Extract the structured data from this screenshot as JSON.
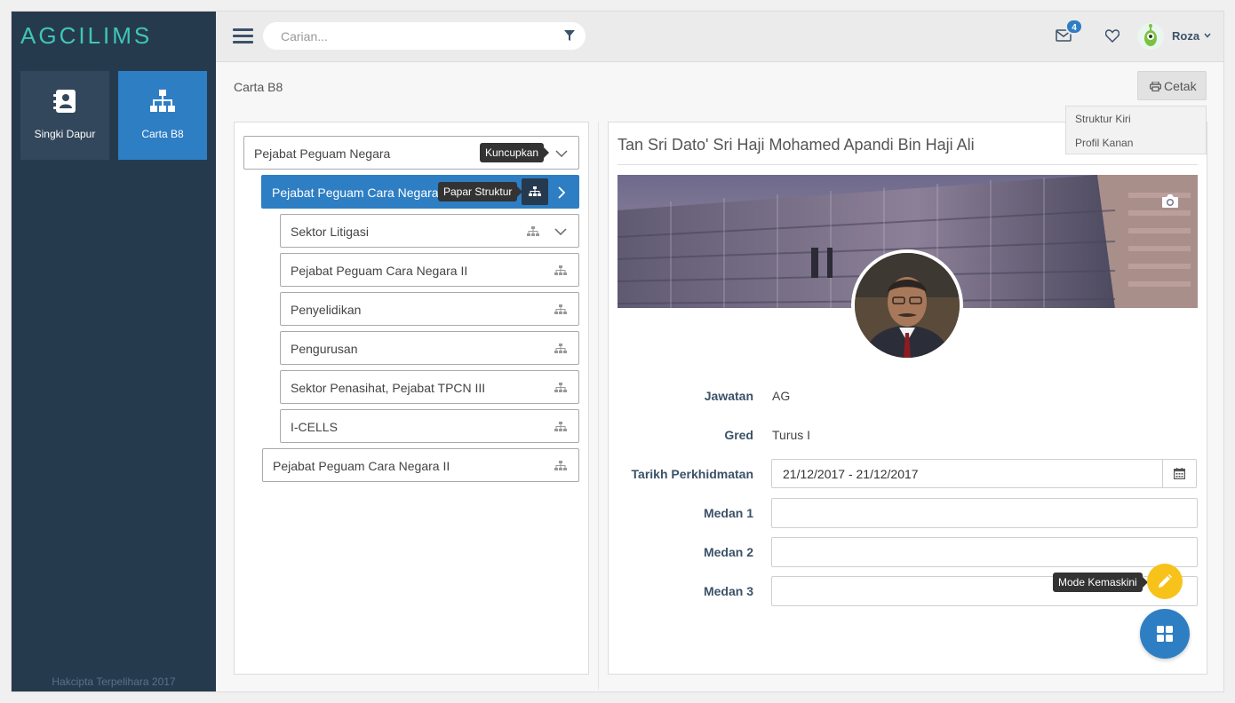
{
  "app": {
    "logo": "AGCILIMS",
    "copyright": "Hakcipta Terpelihara 2017"
  },
  "sidebar": {
    "items": [
      {
        "label": "Singki Dapur",
        "icon": "address-book-icon"
      },
      {
        "label": "Carta B8",
        "icon": "sitemap-icon",
        "active": true
      }
    ]
  },
  "header": {
    "search_placeholder": "Carian...",
    "mail_count": "4",
    "user_name": "Roza"
  },
  "page": {
    "breadcrumb": "Carta B8",
    "print_label": "Cetak",
    "print_menu": [
      "Struktur Kiri",
      "Profil Kanan"
    ]
  },
  "tree": {
    "root": {
      "label": "Pejabat Peguam Negara",
      "tooltip": "Kuncupkan"
    },
    "active": {
      "label": "Pejabat Peguam Cara Negara",
      "tooltip": "Papar Struktur"
    },
    "children": [
      "Sektor Litigasi",
      "Pejabat Peguam Cara Negara II",
      "Penyelidikan",
      "Pengurusan",
      "Sektor Penasihat, Pejabat TPCN III",
      "I-CELLS"
    ],
    "sibling": "Pejabat Peguam Cara Negara II"
  },
  "profile": {
    "name": "Tan Sri Dato' Sri Haji Mohamed Apandi Bin Haji Ali",
    "fields": {
      "jawatan_label": "Jawatan",
      "jawatan_value": "AG",
      "gred_label": "Gred",
      "gred_value": "Turus I",
      "tarikh_label": "Tarikh Perkhidmatan",
      "tarikh_value": "21/12/2017 - 21/12/2017",
      "medan1_label": "Medan 1",
      "medan2_label": "Medan 2",
      "medan3_label": "Medan 3"
    },
    "edit_tooltip": "Mode Kemaskini"
  },
  "colors": {
    "sidebar": "#263a4e",
    "accent": "#2e7ec4",
    "logo": "#3ec7b3",
    "fab_edit": "#f7c31b"
  }
}
